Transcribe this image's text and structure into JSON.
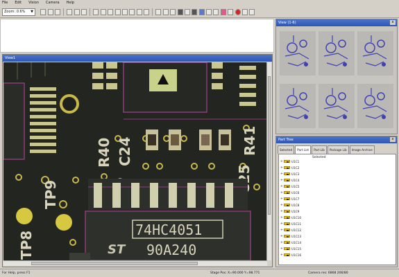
{
  "menu": [
    "File",
    "Edit",
    "Vision",
    "Camera",
    "Help"
  ],
  "toolbar": {
    "zoom_value": "Zoom: 0.6%"
  },
  "pcb_window": {
    "title": "View1",
    "silkscreen": {
      "r40": "R40",
      "c24": "C24",
      "r41": "R41",
      "c25": "C25",
      "tp9": "TP9",
      "tp8": "TP8",
      "chip_line1": "74HC4051",
      "chip_line2": "90A240"
    }
  },
  "preview_panel": {
    "title": "View (1-6)",
    "close_label": "x"
  },
  "tree_panel": {
    "title": "Part Tree",
    "close_label": "x",
    "tabs": [
      "Selected",
      "Part List",
      "Part Lib",
      "Package Lib",
      "Image Archive"
    ],
    "column_header": "Selected",
    "items": [
      "U1C1",
      "U1C2",
      "U1C3",
      "U1C4",
      "U1C5",
      "U1C6",
      "U1C7",
      "U1C8",
      "U1C9",
      "U1C10",
      "U1C11",
      "U1C12",
      "U1C13",
      "U1C14",
      "U1C15",
      "U1C16"
    ]
  },
  "status": {
    "left": "For Help, press F1",
    "mid": "Stage Pos: X=90.000 Y=98.771",
    "right": "Camera res: 6868 206/80"
  }
}
